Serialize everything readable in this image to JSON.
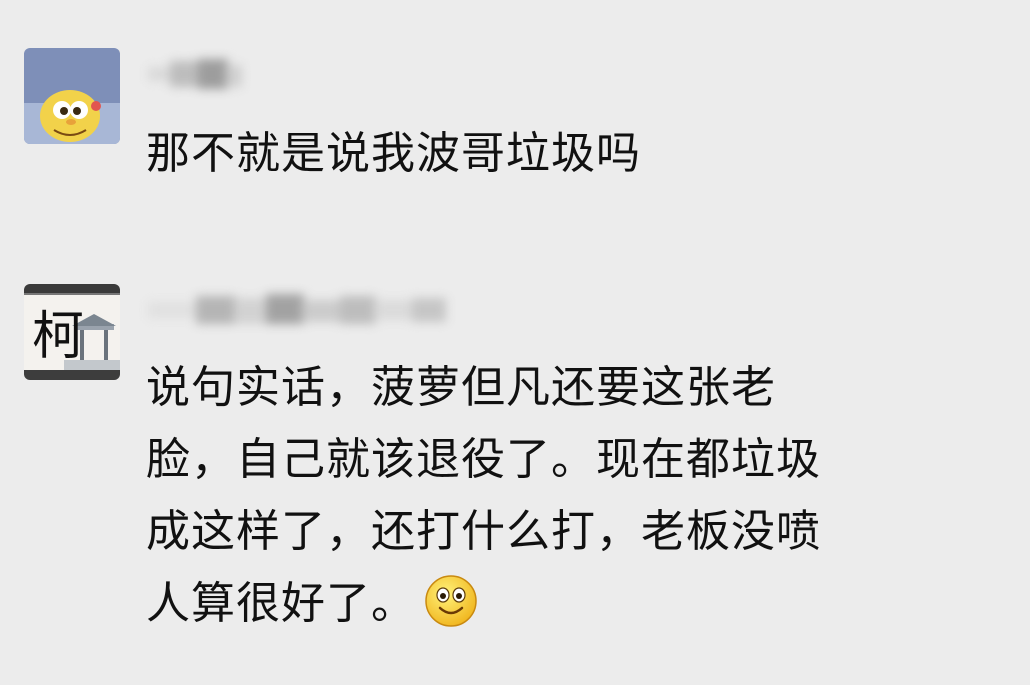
{
  "comments": [
    {
      "text": "那不就是说我波哥垃圾吗"
    },
    {
      "text_lines": [
        "说句实话，菠萝但凡还要这张老",
        "脸，自己就该退役了。现在都垃圾",
        "成这样了，还打什么打，老板没喷",
        "人算很好了。"
      ],
      "emoji": "smile-emoji-icon",
      "avatar_glyph": "柯"
    }
  ],
  "colors": {
    "background": "#ececec",
    "text": "#111111"
  }
}
